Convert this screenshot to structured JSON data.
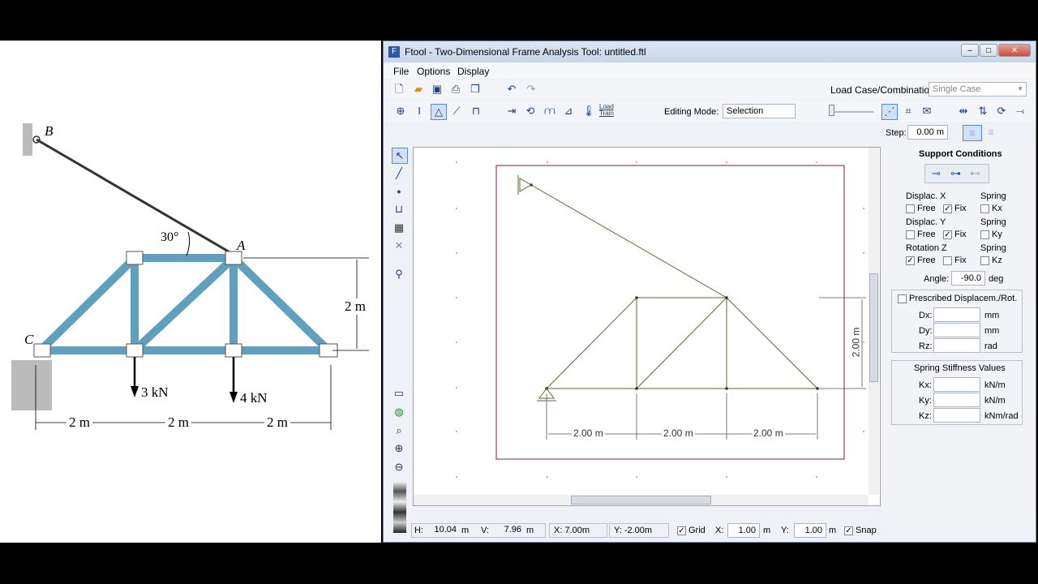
{
  "textbook": {
    "point_b": "B",
    "point_a": "A",
    "point_c": "C",
    "angle": "30°",
    "height": "2 m",
    "load_left": "3 kN",
    "load_right": "4 kN",
    "span_1": "2 m",
    "span_2": "2 m",
    "span_3": "2 m"
  },
  "window": {
    "title": "Ftool - Two-Dimensional Frame Analysis Tool: untitled.ftl",
    "minimize": "–",
    "maximize": "□",
    "close": "✕"
  },
  "menu": {
    "file": "File",
    "options": "Options",
    "display": "Display"
  },
  "toolbar": {
    "load_case_label": "Load Case/Combination:",
    "load_case_value": "Single Case",
    "editing_mode_label": "Editing Mode:",
    "editing_mode_value": "Selection",
    "load_train": "Load Train",
    "step_label": "Step:",
    "step_value": "0.00 m"
  },
  "canvas": {
    "dim_1": "2.00 m",
    "dim_2": "2.00 m",
    "dim_3": "2.00 m",
    "dim_height": "2.00 m"
  },
  "support": {
    "title": "Support Conditions",
    "displac_x": "Displac. X",
    "displac_y": "Displac. Y",
    "rotation_z": "Rotation Z",
    "spring": "Spring",
    "free": "Free",
    "fix": "Fix",
    "kx": "Kx",
    "ky": "Ky",
    "kz": "Kz",
    "angle_label": "Angle:",
    "angle_value": "-90.0",
    "angle_unit": "deg",
    "x_free": false,
    "x_fix": true,
    "x_spring": false,
    "y_free": false,
    "y_fix": true,
    "y_spring": false,
    "z_free": true,
    "z_fix": false,
    "z_spring": false
  },
  "prescribed": {
    "title": "Prescribed Displacem./Rot.",
    "dx": "Dx:",
    "dy": "Dy:",
    "rz": "Rz:",
    "unit_mm": "mm",
    "unit_mm2": "mm",
    "unit_rad": "rad"
  },
  "spring_stiffness": {
    "title": "Spring Stiffness Values",
    "kx": "Kx:",
    "ky": "Ky:",
    "kz": "Kz:",
    "unit_kx": "kN/m",
    "unit_ky": "kN/m",
    "unit_kz": "kNm/rad"
  },
  "status": {
    "h_label": "H:",
    "h_value": "10.04",
    "h_unit": "m",
    "v_label": "V:",
    "v_value": "7.96",
    "v_unit": "m",
    "x_coord": "X: 7.00m",
    "y_coord": "Y: -2.00m",
    "grid_label": "Grid",
    "gx_label": "X:",
    "gx_value": "1.00",
    "gx_unit": "m",
    "gy_label": "Y:",
    "gy_value": "1.00",
    "gy_unit": "m",
    "snap_label": "Snap",
    "grid_checked": true,
    "snap_checked": true
  }
}
